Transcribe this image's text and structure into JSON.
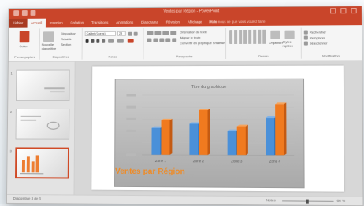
{
  "app": {
    "title": "Ventes par Région - PowerPoint",
    "accent_color": "#c9452a"
  },
  "tabs": [
    {
      "label": "Fichier"
    },
    {
      "label": "Accueil",
      "active": true
    },
    {
      "label": "Insertion"
    },
    {
      "label": "Création"
    },
    {
      "label": "Transitions"
    },
    {
      "label": "Animations"
    },
    {
      "label": "Diaporama"
    },
    {
      "label": "Révision"
    },
    {
      "label": "Affichage"
    },
    {
      "label": "Aide"
    }
  ],
  "tell_me": "Dites-nous ce que vous voulez faire",
  "ribbon": {
    "clipboard": {
      "label": "Presse-papiers",
      "paste": "Coller"
    },
    "slides": {
      "label": "Diapositives",
      "new_slide": "Nouvelle diapositive",
      "layout": "Disposition",
      "reset": "Rétablir",
      "section": "Section"
    },
    "font": {
      "label": "Police",
      "font_name": "Calibri (Corps)",
      "font_size": "24"
    },
    "paragraph": {
      "label": "Paragraphe",
      "text_direction": "Orientation du texte",
      "align_text": "Aligner le texte",
      "smartart": "Convertir en graphique SmartArt"
    },
    "drawing": {
      "label": "Dessin",
      "arrange": "Organiser",
      "quick_styles": "Styles rapides"
    },
    "editing": {
      "label": "Modification",
      "find": "Rechercher",
      "replace": "Remplacer",
      "select": "Sélectionner"
    }
  },
  "thumbnails": [
    {
      "number": "1"
    },
    {
      "number": "2"
    },
    {
      "number": "3",
      "selected": true
    }
  ],
  "slide": {
    "title": "Ventes par Région",
    "title_color": "#f08a23"
  },
  "chart_data": {
    "type": "bar",
    "title": "Titre du graphique",
    "categories": [
      "Zone 1",
      "Zone 2",
      "Zone 3",
      "Zone 4"
    ],
    "series": [
      {
        "values": [
          45,
          52,
          40,
          62
        ],
        "color": "#4a90d9"
      },
      {
        "values": [
          58,
          75,
          48,
          85
        ],
        "color": "#f07a1f"
      }
    ],
    "ylim": [
      0,
      100
    ],
    "grid": true
  },
  "statusbar": {
    "slide_indicator": "Diapositive 3 de 3",
    "notes": "Notes",
    "zoom": "66 %"
  }
}
